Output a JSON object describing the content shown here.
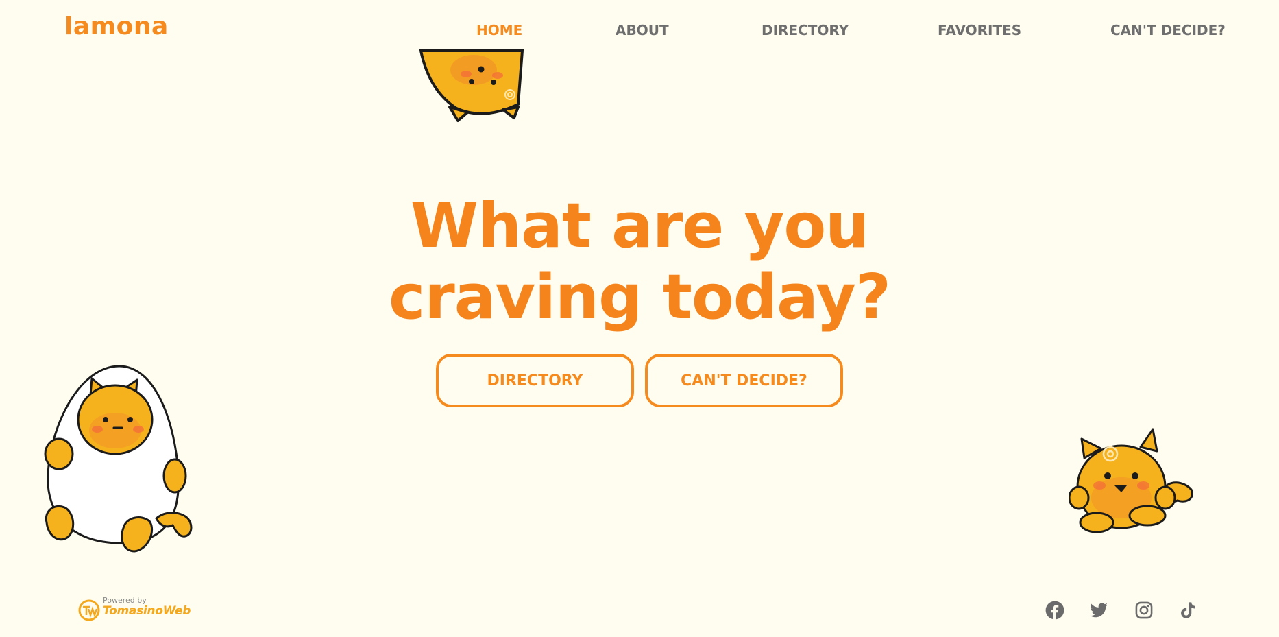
{
  "brand": {
    "logo_text": "lamona"
  },
  "nav": {
    "items": [
      {
        "label": "HOME",
        "active": true
      },
      {
        "label": "ABOUT",
        "active": false
      },
      {
        "label": "DIRECTORY",
        "active": false
      },
      {
        "label": "FAVORITES",
        "active": false
      },
      {
        "label": "CAN'T DECIDE?",
        "active": false
      }
    ]
  },
  "hero": {
    "title_line1": "What are you",
    "title_line2": "craving today?",
    "buttons": [
      {
        "label": "DIRECTORY"
      },
      {
        "label": "CAN'T DECIDE?"
      }
    ]
  },
  "footer": {
    "powered_by_label": "Powered by",
    "powered_by_brand": "TomasinoWeb",
    "social_icons": [
      "facebook-icon",
      "twitter-icon",
      "instagram-icon",
      "tiktok-icon"
    ]
  },
  "colors": {
    "accent": "#f58a1f",
    "background": "#fffdf0",
    "nav_text": "#6e6e6e",
    "social_icon": "#6b6b6b"
  }
}
